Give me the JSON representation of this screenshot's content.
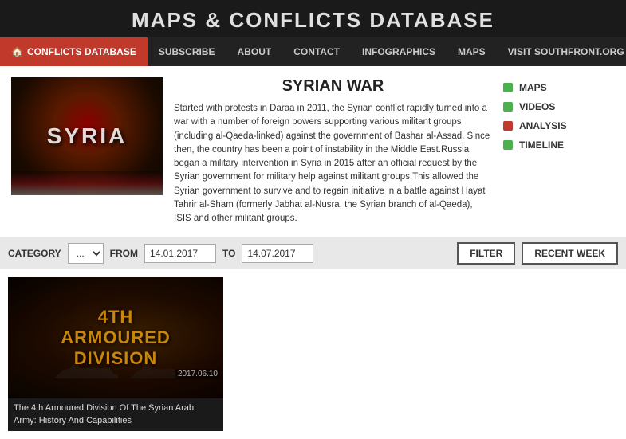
{
  "site": {
    "title": "MAPS & CONFLICTS DATABASE"
  },
  "nav": {
    "items": [
      {
        "id": "conflicts-database",
        "label": "CONFLICTS DATABASE",
        "active": true,
        "has_home_icon": true
      },
      {
        "id": "subscribe",
        "label": "SUBSCRIBE",
        "active": false
      },
      {
        "id": "about",
        "label": "ABOUT",
        "active": false
      },
      {
        "id": "contact",
        "label": "CONTACT",
        "active": false
      },
      {
        "id": "infographics",
        "label": "INFOGRAPHICS",
        "active": false
      },
      {
        "id": "maps",
        "label": "MAPS",
        "active": false
      },
      {
        "id": "visit-southfront",
        "label": "VISIT SOUTHFRONT.ORG",
        "active": false
      }
    ]
  },
  "article": {
    "title": "SYRIAN WAR",
    "image_text": "SYRIA",
    "description": "Started with protests in Daraa in 2011, the Syrian conflict rapidly turned into a war with a number of foreign powers supporting various militant groups (including al-Qaeda-linked) against the government of Bashar al-Assad. Since then, the country has been a point of instability in the Middle East.Russia began a military intervention in Syria in 2015 after an official request by the Syrian government for military help against militant groups.This allowed the Syrian government to survive and to regain initiative in a battle against Hayat Tahrir al-Sham (formerly Jabhat al-Nusra, the Syrian branch of al-Qaeda), ISIS and other militant groups.",
    "sidebar_links": [
      {
        "id": "maps",
        "label": "MAPS",
        "dot_color": "dot-green"
      },
      {
        "id": "videos",
        "label": "VIDEOS",
        "dot_color": "dot-green"
      },
      {
        "id": "analysis",
        "label": "ANALYSIS",
        "dot_color": "dot-red"
      },
      {
        "id": "timeline",
        "label": "TIMELINE",
        "dot_color": "dot-green"
      }
    ]
  },
  "filter": {
    "category_label": "CATEGORY",
    "category_value": "...",
    "from_label": "FROM",
    "from_date": "14.01.2017",
    "to_label": "TO",
    "to_date": "14.07.2017",
    "filter_button": "FILTER",
    "recent_week_button": "RECENT WEEK"
  },
  "cards": [
    {
      "id": "card-1",
      "thumb_line1": "4TH",
      "thumb_line2": "ARMOURED",
      "thumb_line3": "DIVISION",
      "date": "2017.06.10",
      "title": "The 4th Armoured Division Of The Syrian Arab Army: History And Capabilities"
    }
  ]
}
